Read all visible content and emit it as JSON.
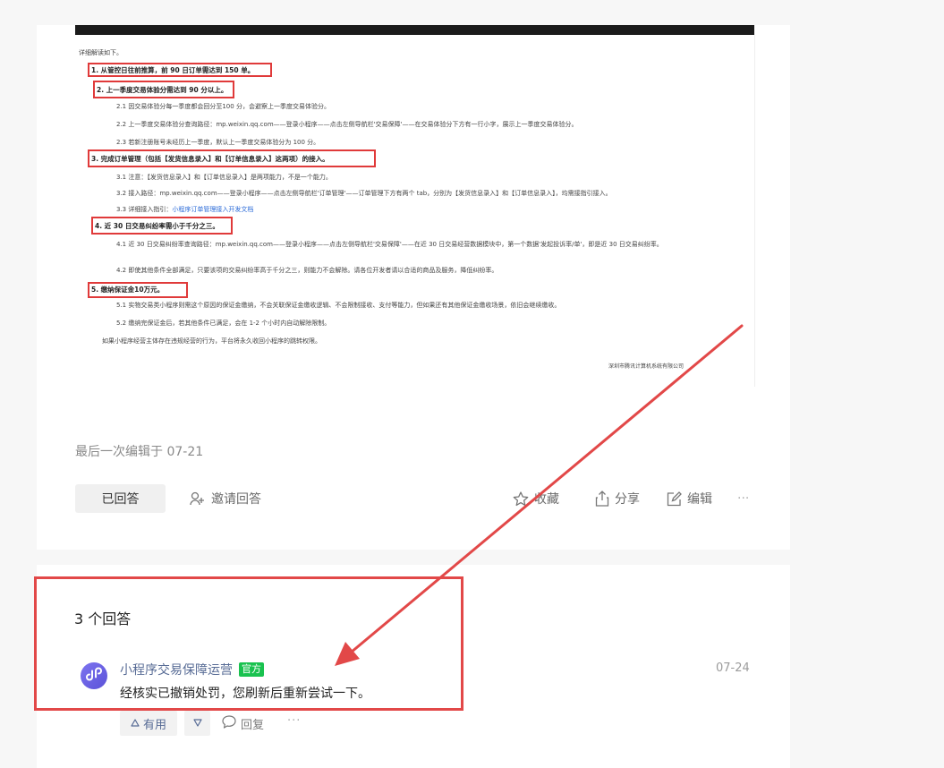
{
  "document_image": {
    "intro": "详细解读如下。",
    "items": [
      {
        "type": "heading",
        "text": "1. 从管控日往前推算，前 90 日订单需达到 150 单。"
      },
      {
        "type": "heading",
        "text": "2. 上一季度交易体验分需达到 90 分以上。"
      },
      {
        "type": "sub",
        "text": "2.1 因交易体验分每一季度都会回分至100 分，会避察上一季度交易体验分。"
      },
      {
        "type": "sub",
        "text": "2.2 上一季度交易体验分查询路径：mp.weixin.qq.com——登录小程序——点击左侧导航栏'交易保障'——在交易体验分下方有一行小字，展示上一季度交易体验分。"
      },
      {
        "type": "sub",
        "text": "2.3 若新注册账号未经历上一季度，默认上一季度交易体验分为 100 分。"
      },
      {
        "type": "heading",
        "text": "3. 完成订单管理（包括【发货信息录入】和【订单信息录入】这两项）的接入。"
      },
      {
        "type": "sub",
        "text": "3.1 注意：【发货信息录入】和【订单信息录入】是两项能力，不是一个能力。"
      },
      {
        "type": "sub",
        "text": "3.2 接入路径：mp.weixin.qq.com——登录小程序——点击左侧导航栏'订单管理'——订单管理下方有两个 tab，分别为【发货信息录入】和【订单信息录入】，均需接指引接入。"
      },
      {
        "type": "sub",
        "text": "3.3 详细接入指引：",
        "link": "小程序订单管理接入开发文档"
      },
      {
        "type": "heading",
        "text": "4. 近 30 日交易纠纷率需小于千分之三。"
      },
      {
        "type": "sub",
        "text": "4.1 近 30 日交易纠纷率查询路径：mp.weixin.qq.com——登录小程序——点击左侧导航栏'交易保障'——在近 30 日交易经营数据模块中，第一个数据'发起投诉率/单'，即是近 30 日交易纠纷率。"
      },
      {
        "type": "sub",
        "text": "4.2 即使其他条件全部满足，只要该项的交易纠纷率高于千分之三，则能力不会解除。请各位开发者请以合适的商品及服务，降低纠纷率。"
      },
      {
        "type": "heading",
        "text": "5. 缴纳保证金10万元。"
      },
      {
        "type": "sub",
        "text": "5.1 实物交易类小程序则需这个原因的保证金缴纳，不会关联保证金缴收逻辑、不会限制接收、支付等能力，但如果还有其他保证金缴收场景，依旧会继续缴收。"
      },
      {
        "type": "sub",
        "text": "5.2 缴纳完保证金后，若其他条件已满足，会在 1-2 个小时内自动解除限制。"
      },
      {
        "type": "plain",
        "text": "如果小程序经营主体存在违规经营的行为，平台将永久收回小程序的跳转权限。"
      }
    ],
    "signature": "深圳市腾讯计算机系统有限公司"
  },
  "post": {
    "edit_info": "最后一次编辑于  07-21",
    "answered_label": "已回答",
    "invite_label": "邀请回答",
    "favorite_label": "收藏",
    "share_label": "分享",
    "edit_label": "编辑",
    "more_label": "···"
  },
  "answers": {
    "count_label": "3 个回答",
    "first": {
      "author": "小程序交易保障运营",
      "badge": "官方",
      "date": "07-24",
      "text": "经核实已撤销处罚，您刷新后重新尝试一下。",
      "useful_label": "有用",
      "reply_label": "回复",
      "more_label": "···"
    }
  },
  "colors": {
    "annotation_red": "#e24848",
    "link_blue": "#576b95",
    "badge_green": "#19c24f",
    "avatar_purple": "#6b62e6"
  },
  "icons": [
    "invite-icon",
    "star-icon",
    "share-icon",
    "edit-icon",
    "thumbs-up-icon",
    "thumbs-down-icon",
    "comment-icon",
    "miniprogram-logo-icon"
  ]
}
